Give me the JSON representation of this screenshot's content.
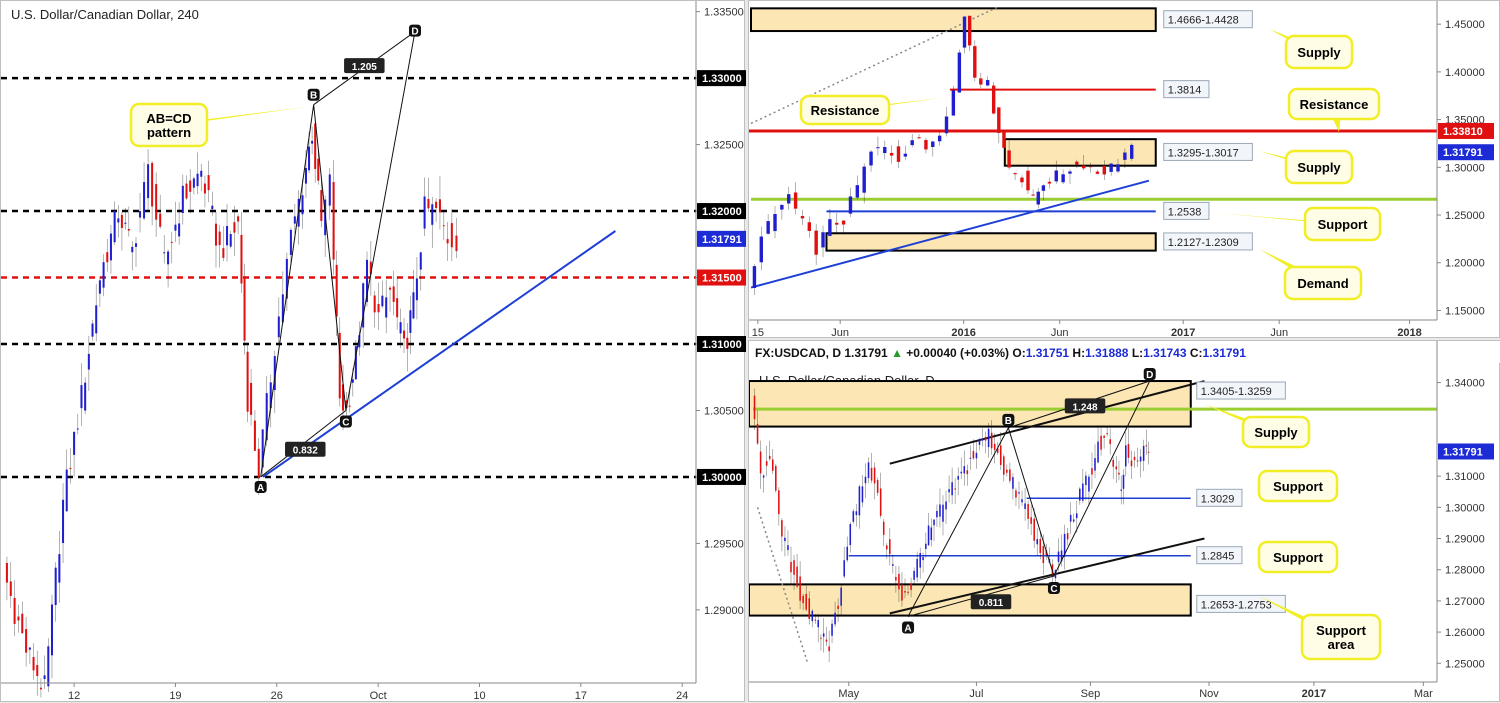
{
  "colors": {
    "up": "#1f1fcf",
    "down": "#e01010",
    "black": "#000000",
    "callout_fill": "#fffde6",
    "callout_stroke": "#f2ee25",
    "zone_fill": "#fbe6b4",
    "green": "#9acd32"
  },
  "chart_data": [
    {
      "type": "candlestick",
      "symbol": "U.S. Dollar/Canadian Dollar, 240",
      "ylim": [
        1.2845,
        1.3355
      ],
      "xlim": [
        0,
        30
      ],
      "x_ticks": [
        {
          "x": 3,
          "label": "12"
        },
        {
          "x": 7.4,
          "label": "19"
        },
        {
          "x": 11.8,
          "label": "26"
        },
        {
          "x": 16.2,
          "label": "Oct"
        },
        {
          "x": 20.6,
          "label": "10"
        },
        {
          "x": 25,
          "label": "17"
        },
        {
          "x": 29.4,
          "label": "24"
        }
      ],
      "y_ticks": [
        1.29,
        1.295,
        1.3,
        1.305,
        1.31,
        1.315,
        1.32,
        1.325,
        1.33,
        1.335
      ],
      "y_tick_labels": [
        "1.29000",
        "1.29500",
        "1.30000",
        "1.30500",
        "1.31000",
        "1.31500",
        "1.32000",
        "1.32500",
        "1.33000",
        "1.33500"
      ],
      "current_price": {
        "value": 1.31791,
        "label": "1.31791"
      },
      "levels": [
        {
          "value": 1.33,
          "label": "1.33000",
          "color": "black"
        },
        {
          "value": 1.32,
          "label": "1.32000",
          "color": "black"
        },
        {
          "value": 1.315,
          "label": "1.31500",
          "color": "red"
        },
        {
          "value": 1.31,
          "label": "1.31000",
          "color": "black"
        },
        {
          "value": 1.3,
          "label": "1.30000",
          "color": "black"
        }
      ],
      "pattern": {
        "A": [
          11.1,
          1.3
        ],
        "B": [
          13.4,
          1.328
        ],
        "C": [
          14.8,
          1.305
        ],
        "D": [
          17.8,
          1.3335
        ],
        "labels": [
          "A",
          "B",
          "C",
          "D"
        ],
        "ratio_ab": "0.832",
        "ratio_cd": "1.205"
      },
      "trendline": [
        [
          11.2,
          1.3
        ],
        [
          26.5,
          1.3185
        ]
      ],
      "callouts": [
        {
          "text1": "AB=CD",
          "text2": "pattern"
        }
      ],
      "path": [
        [
          0,
          1.293
        ],
        [
          1,
          1.287
        ],
        [
          1.8,
          1.284
        ],
        [
          2.6,
          1.298
        ],
        [
          3.4,
          1.306
        ],
        [
          4.2,
          1.315
        ],
        [
          5,
          1.32
        ],
        [
          5.6,
          1.317
        ],
        [
          6.3,
          1.323
        ],
        [
          7,
          1.316
        ],
        [
          7.8,
          1.321
        ],
        [
          8.6,
          1.323
        ],
        [
          9.4,
          1.317
        ],
        [
          10.2,
          1.319
        ],
        [
          10.6,
          1.306
        ],
        [
          11.1,
          1.3005
        ],
        [
          11.8,
          1.31
        ],
        [
          12.5,
          1.318
        ],
        [
          13,
          1.322
        ],
        [
          13.4,
          1.326
        ],
        [
          13.8,
          1.319
        ],
        [
          14.2,
          1.322
        ],
        [
          14.6,
          1.306
        ],
        [
          14.9,
          1.305
        ],
        [
          15.3,
          1.309
        ],
        [
          15.8,
          1.316
        ],
        [
          16.3,
          1.312
        ],
        [
          16.8,
          1.314
        ],
        [
          17.4,
          1.3095
        ],
        [
          17.8,
          1.313
        ],
        [
          18.3,
          1.32
        ],
        [
          18.8,
          1.32
        ],
        [
          19.3,
          1.318
        ],
        [
          19.7,
          1.3179
        ]
      ]
    },
    {
      "type": "candlestick",
      "symbol": "U.S. Dollar/Canadian Dollar, W",
      "ylim": [
        1.14,
        1.468
      ],
      "xlim": [
        0,
        100
      ],
      "x_ticks": [
        {
          "x": 1,
          "label": "15"
        },
        {
          "x": 13,
          "label": "Jun"
        },
        {
          "x": 31,
          "label": "2016"
        },
        {
          "x": 45,
          "label": "Jun"
        },
        {
          "x": 63,
          "label": "2017"
        },
        {
          "x": 77,
          "label": "Jun"
        },
        {
          "x": 96,
          "label": "2018"
        }
      ],
      "y_ticks": [
        1.15,
        1.2,
        1.25,
        1.3,
        1.35,
        1.4,
        1.45
      ],
      "y_tick_labels": [
        "1.15000",
        "1.20000",
        "1.25000",
        "1.30000",
        "1.35000",
        "1.40000",
        "1.45000"
      ],
      "current_price": {
        "value": 1.31791,
        "label": "1.31791"
      },
      "resistance_level": {
        "value": 1.3381,
        "label": "1.33810"
      },
      "zones": [
        {
          "top": 1.4666,
          "bottom": 1.4428,
          "x0": 0,
          "x1": 59,
          "label": "1.4666-1.4428",
          "callout": "Supply"
        },
        {
          "top": 1.3295,
          "bottom": 1.3017,
          "x0": 37,
          "x1": 59,
          "label": "1.3295-1.3017",
          "callout": "Supply"
        },
        {
          "top": 1.2309,
          "bottom": 1.2127,
          "x0": 11,
          "x1": 59,
          "label": "1.2127-1.2309",
          "callout": "Demand"
        }
      ],
      "lines": [
        {
          "value": 1.3814,
          "x0": 29,
          "x1": 59,
          "label": "1.3814",
          "color": "red"
        },
        {
          "value": 1.2538,
          "x0": 11,
          "x1": 59,
          "label": "1.2538",
          "color": "blue",
          "callout": "Support"
        },
        {
          "value": 1.2665,
          "x0": 0,
          "x1": 100,
          "color": "green"
        }
      ],
      "callouts": [
        {
          "text": "Supply"
        },
        {
          "text": "Resistance"
        },
        {
          "text": "Supply"
        },
        {
          "text": "Support"
        },
        {
          "text": "Demand"
        },
        {
          "text": "Resistance"
        }
      ],
      "trendline": [
        [
          0,
          1.174
        ],
        [
          58,
          1.286
        ]
      ],
      "dotted_line": [
        [
          0,
          1.346
        ],
        [
          36,
          1.468
        ]
      ],
      "path": [
        [
          0,
          1.18
        ],
        [
          2,
          1.225
        ],
        [
          4,
          1.25
        ],
        [
          6,
          1.27
        ],
        [
          8,
          1.24
        ],
        [
          10,
          1.215
        ],
        [
          12,
          1.24
        ],
        [
          14,
          1.245
        ],
        [
          16,
          1.28
        ],
        [
          18,
          1.315
        ],
        [
          20,
          1.32
        ],
        [
          22,
          1.31
        ],
        [
          24,
          1.33
        ],
        [
          26,
          1.32
        ],
        [
          28,
          1.34
        ],
        [
          30,
          1.38
        ],
        [
          31.5,
          1.46
        ],
        [
          33,
          1.4
        ],
        [
          35,
          1.385
        ],
        [
          36.5,
          1.34
        ],
        [
          38,
          1.3
        ],
        [
          40,
          1.29
        ],
        [
          41.5,
          1.265
        ],
        [
          43,
          1.285
        ],
        [
          45,
          1.29
        ],
        [
          47,
          1.3
        ],
        [
          49,
          1.305
        ],
        [
          51,
          1.295
        ],
        [
          53,
          1.3
        ],
        [
          55,
          1.315
        ],
        [
          56,
          1.318
        ]
      ]
    },
    {
      "type": "candlestick",
      "symbol": "U.S. Dollar/Canadian Dollar, D",
      "info": {
        "ticker": "FX:USDCAD, D",
        "last": "1.31791",
        "change": "+0.00040 (+0.03%)",
        "open": "1.31751",
        "high": "1.31888",
        "low": "1.31743",
        "close": "1.31791",
        "o_label": "O:",
        "h_label": "H:",
        "l_label": "L:",
        "c_label": "C:"
      },
      "ylim": [
        1.244,
        1.345
      ],
      "xlim": [
        0,
        100
      ],
      "x_ticks": [
        {
          "x": 21,
          "label": "May"
        },
        {
          "x": 49,
          "label": "Jul"
        },
        {
          "x": 74,
          "label": "Sep"
        },
        {
          "x": 100,
          "label": "Nov"
        },
        {
          "x": 123,
          "label": "2017"
        },
        {
          "x": 147,
          "label": "Mar"
        }
      ],
      "y_ticks": [
        1.25,
        1.26,
        1.27,
        1.28,
        1.29,
        1.3,
        1.31,
        1.34
      ],
      "y_tick_labels": [
        "1.25000",
        "1.26000",
        "1.27000",
        "1.28000",
        "1.29000",
        "1.30000",
        "1.31000",
        "1.34000"
      ],
      "current_price": {
        "value": 1.31791,
        "label": "1.31791"
      },
      "zones": [
        {
          "top": 1.3405,
          "bottom": 1.3259,
          "label": "1.3405-1.3259",
          "callout": "Supply"
        },
        {
          "top": 1.2753,
          "bottom": 1.2653,
          "label": "1.2653-1.2753",
          "callout": "Support area"
        }
      ],
      "lines": [
        {
          "value": 1.3029,
          "x0": 60,
          "x1": 96,
          "label": "1.3029",
          "color": "blue",
          "callout": "Support"
        },
        {
          "value": 1.2845,
          "x0": 21,
          "x1": 96,
          "label": "1.2845",
          "color": "blue",
          "callout": "Support"
        },
        {
          "value": 1.3315,
          "x0": 0,
          "x1": 150,
          "color": "green"
        }
      ],
      "pattern": {
        "A": [
          34,
          1.265
        ],
        "B": [
          56,
          1.3255
        ],
        "C": [
          66,
          1.278
        ],
        "D": [
          87,
          1.3405
        ],
        "labels": [
          "A",
          "B",
          "C",
          "D"
        ],
        "ratio_ab": "0.811",
        "ratio_cd": "1.248"
      },
      "channel": [
        [
          [
            30,
            1.266
          ],
          [
            99,
            1.29
          ]
        ],
        [
          [
            30,
            1.314
          ],
          [
            99,
            1.3405
          ]
        ]
      ],
      "callouts": [
        {
          "text": "Supply"
        },
        {
          "text": "Support"
        },
        {
          "text": "Support"
        },
        {
          "text1": "Support",
          "text2": "area"
        }
      ],
      "path": [
        [
          0,
          1.333
        ],
        [
          2,
          1.31
        ],
        [
          4,
          1.318
        ],
        [
          6,
          1.295
        ],
        [
          8,
          1.285
        ],
        [
          10,
          1.275
        ],
        [
          12,
          1.268
        ],
        [
          14,
          1.262
        ],
        [
          17,
          1.256
        ],
        [
          19,
          1.27
        ],
        [
          21,
          1.29
        ],
        [
          23,
          1.3
        ],
        [
          25,
          1.312
        ],
        [
          27,
          1.31
        ],
        [
          29,
          1.29
        ],
        [
          31,
          1.28
        ],
        [
          33,
          1.272
        ],
        [
          35,
          1.275
        ],
        [
          37,
          1.285
        ],
        [
          40,
          1.295
        ],
        [
          42,
          1.3
        ],
        [
          44,
          1.305
        ],
        [
          46,
          1.31
        ],
        [
          48,
          1.315
        ],
        [
          50,
          1.32
        ],
        [
          52,
          1.323
        ],
        [
          54,
          1.318
        ],
        [
          56,
          1.31
        ],
        [
          58,
          1.305
        ],
        [
          60,
          1.3
        ],
        [
          62,
          1.29
        ],
        [
          64,
          1.285
        ],
        [
          66,
          1.278
        ],
        [
          68,
          1.287
        ],
        [
          70,
          1.295
        ],
        [
          72,
          1.303
        ],
        [
          74,
          1.31
        ],
        [
          76,
          1.32
        ],
        [
          78,
          1.322
        ],
        [
          80,
          1.31
        ],
        [
          81,
          1.305
        ],
        [
          82,
          1.318
        ],
        [
          84,
          1.312
        ],
        [
          86,
          1.318
        ],
        [
          87,
          1.3179
        ]
      ]
    }
  ],
  "callout_text": {
    "abcd": [
      "AB=CD",
      "pattern"
    ],
    "w_supply_top": "Supply",
    "w_resistance_left": "Resistance",
    "w_resistance_right": "Resistance",
    "w_supply_mid": "Supply",
    "w_support": "Support",
    "w_demand": "Demand",
    "d_supply": "Supply",
    "d_support1": "Support",
    "d_support2": "Support",
    "d_support_area": [
      "Support",
      "area"
    ]
  }
}
